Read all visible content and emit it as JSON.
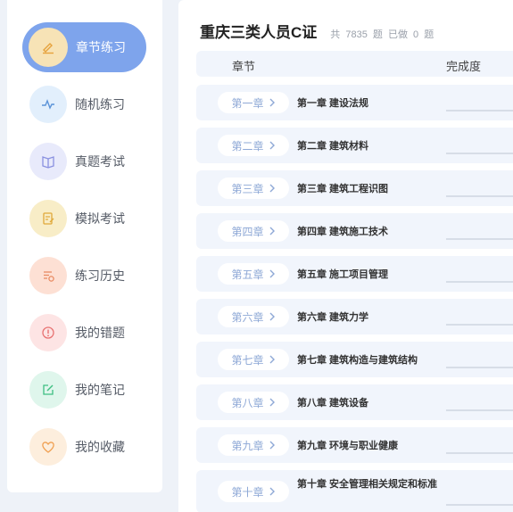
{
  "sidebar": {
    "items": [
      {
        "label": "章节练习",
        "icon": "pencil-icon",
        "active": true
      },
      {
        "label": "随机练习",
        "icon": "pulse-icon"
      },
      {
        "label": "真题考试",
        "icon": "book-icon"
      },
      {
        "label": "模拟考试",
        "icon": "document-edit-icon"
      },
      {
        "label": "练习历史",
        "icon": "history-list-icon"
      },
      {
        "label": "我的错题",
        "icon": "alert-circle-icon"
      },
      {
        "label": "我的笔记",
        "icon": "note-edit-icon"
      },
      {
        "label": "我的收藏",
        "icon": "heart-icon"
      }
    ]
  },
  "header": {
    "title": "重庆三类人员C证",
    "stats": {
      "total_prefix": "共",
      "total": "7835",
      "total_unit": "题",
      "done_prefix": "已做",
      "done": "0",
      "done_unit": "题"
    }
  },
  "table": {
    "headers": {
      "chapter": "章节",
      "progress": "完成度"
    },
    "rows": [
      {
        "chapter": "第一章",
        "title": "第一章 建设法规"
      },
      {
        "chapter": "第二章",
        "title": "第二章 建筑材料"
      },
      {
        "chapter": "第三章",
        "title": "第三章 建筑工程识图"
      },
      {
        "chapter": "第四章",
        "title": "第四章 建筑施工技术"
      },
      {
        "chapter": "第五章",
        "title": "第五章 施工项目管理"
      },
      {
        "chapter": "第六章",
        "title": "第六章 建筑力学"
      },
      {
        "chapter": "第七章",
        "title": "第七章 建筑构造与建筑结构"
      },
      {
        "chapter": "第八章",
        "title": "第八章 建筑设备"
      },
      {
        "chapter": "第九章",
        "title": "第九章 环境与职业健康"
      },
      {
        "chapter": "第十章",
        "title": "第十章 安全管理相关规定和标准"
      }
    ]
  },
  "colors": {
    "accent": "#7ea4ec",
    "chapter_text": "#8ea8d6",
    "row_bg": "#f1f5fc"
  }
}
